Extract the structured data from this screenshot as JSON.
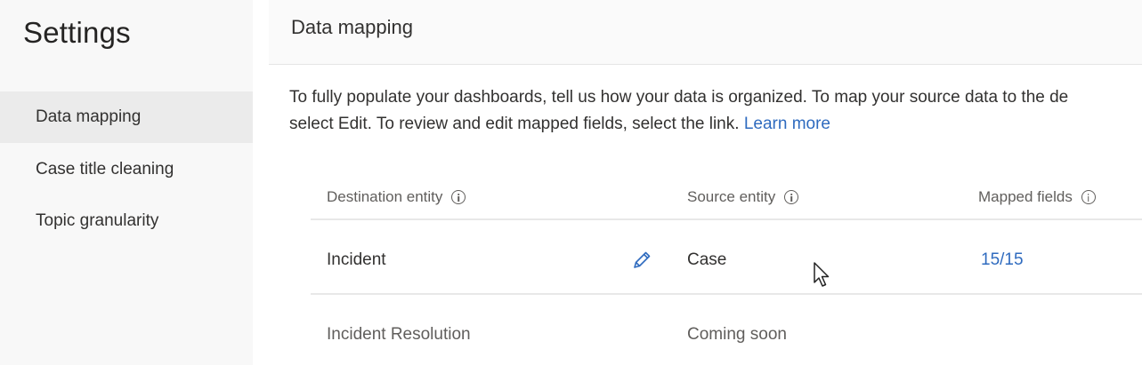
{
  "sidebar": {
    "title": "Settings",
    "items": [
      {
        "label": "Data mapping",
        "active": true
      },
      {
        "label": "Case title cleaning",
        "active": false
      },
      {
        "label": "Topic granularity",
        "active": false
      }
    ]
  },
  "main": {
    "title": "Data mapping",
    "description_line1": "To fully populate your dashboards, tell us how your data is organized. To map your source data to the de",
    "description_line2": "select Edit. To review and edit mapped fields, select the link.",
    "learn_more": "Learn more"
  },
  "table": {
    "columns": [
      {
        "label": "Destination entity",
        "icon": "info-icon"
      },
      {
        "label": "Source entity",
        "icon": "info-icon"
      },
      {
        "label": "Mapped fields",
        "icon": "info-icon"
      }
    ],
    "rows": [
      {
        "destination": "Incident",
        "source": "Case",
        "mapped": "15/15",
        "edit_icon": "pencil-icon"
      },
      {
        "destination": "Incident Resolution",
        "source": "Coming soon",
        "mapped": ""
      }
    ]
  },
  "colors": {
    "accent": "#2f6bbf",
    "sidebar_bg": "#f8f8f8",
    "active_bg": "#ebebeb"
  }
}
